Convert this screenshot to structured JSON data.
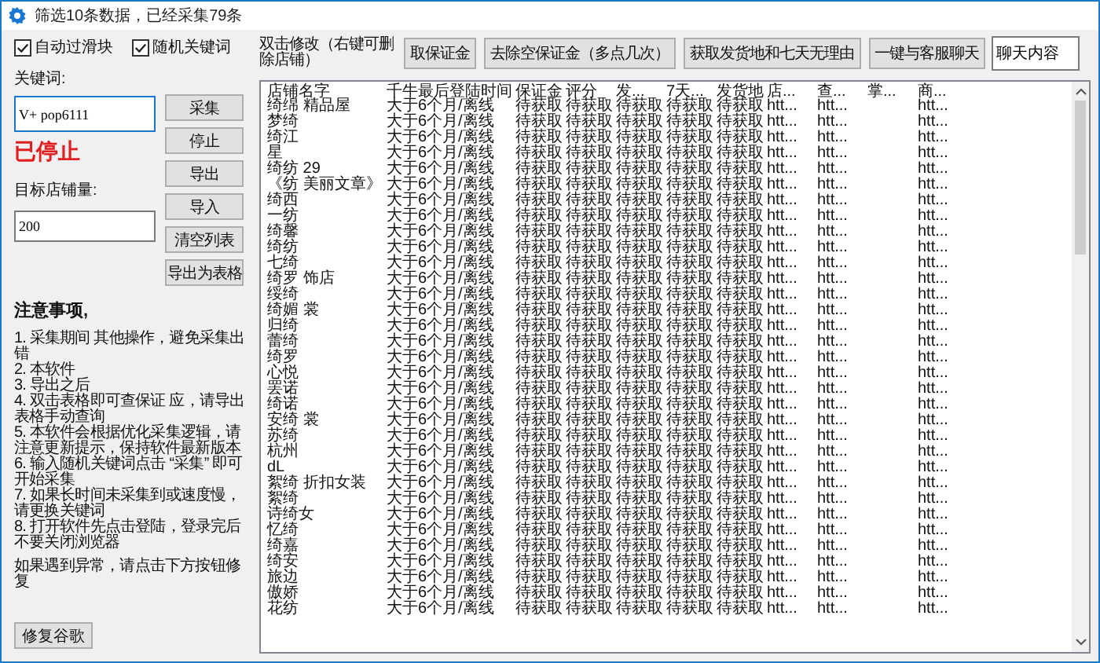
{
  "window": {
    "title": "筛选10条数据，已经采集79条"
  },
  "options": [
    {
      "label": "自动过滑块",
      "checked": true
    },
    {
      "label": "随机关键词",
      "checked": true
    }
  ],
  "keyword": {
    "label": "关键词:",
    "value": "V+ pop6111"
  },
  "status": {
    "text": "已停止",
    "kind": "stopped"
  },
  "target": {
    "label": "目标店铺量:",
    "value": "200"
  },
  "side_buttons": [
    "采集",
    "停止",
    "导出",
    "导入",
    "清空列表",
    "导出为表格"
  ],
  "notes": {
    "title": "注意事项,",
    "items": [
      "1. 采集期间 其他操作，避免采集出错",
      "2. 本软件",
      "3. 导出之后",
      "4. 双击表格即可查保证 应，请导出表格手动查询",
      "5. 本软件会根据优化采集逻辑，请注意更新提示，保持软件最新版本",
      "6. 输入随机关键词点击 “采集” 即可开始采集",
      "7. 如果长时间未采集到或速度慢，请更换关键词",
      "8. 打开软件先点击登陆，登录完后不要关闭浏览器"
    ],
    "footer": "如果遇到异常，请点击下方按钮修复"
  },
  "repair_button": "修复谷歌",
  "table_hint": "双击修改（右键可删除店铺）",
  "top_buttons": [
    "取保证金",
    "去除空保证金（多点几次）",
    "获取发货地和七天无理由",
    "一键与客服聊天"
  ],
  "chat": {
    "value": "聊天内容"
  },
  "table": {
    "columns": [
      "店铺名字",
      "千牛最后登陆时间",
      "保证金",
      "评分",
      "发...",
      "7天...",
      "发货地",
      "店...",
      "查...",
      "掌...",
      "商..."
    ],
    "rows": [
      [
        "绮绵 精品屋",
        "大于6个月/离线",
        "待获取",
        "待获取",
        "待获取",
        "待获取",
        "待获取",
        "htt...",
        "htt...",
        "",
        "htt..."
      ],
      [
        "梦绮",
        "大于6个月/离线",
        "待获取",
        "待获取",
        "待获取",
        "待获取",
        "待获取",
        "htt...",
        "htt...",
        "",
        "htt..."
      ],
      [
        "绮江",
        "大于6个月/离线",
        "待获取",
        "待获取",
        "待获取",
        "待获取",
        "待获取",
        "htt...",
        "htt...",
        "",
        "htt..."
      ],
      [
        "星",
        "大于6个月/离线",
        "待获取",
        "待获取",
        "待获取",
        "待获取",
        "待获取",
        "htt...",
        "htt...",
        "",
        "htt..."
      ],
      [
        "绮纺 29",
        "大于6个月/离线",
        "待获取",
        "待获取",
        "待获取",
        "待获取",
        "待获取",
        "htt...",
        "htt...",
        "",
        "htt..."
      ],
      [
        "《纺 美丽文章》",
        "大于6个月/离线",
        "待获取",
        "待获取",
        "待获取",
        "待获取",
        "待获取",
        "htt...",
        "htt...",
        "",
        "htt..."
      ],
      [
        "绮西",
        "大于6个月/离线",
        "待获取",
        "待获取",
        "待获取",
        "待获取",
        "待获取",
        "htt...",
        "htt...",
        "",
        "htt..."
      ],
      [
        "一纺",
        "大于6个月/离线",
        "待获取",
        "待获取",
        "待获取",
        "待获取",
        "待获取",
        "htt...",
        "htt...",
        "",
        "htt..."
      ],
      [
        "绮馨",
        "大于6个月/离线",
        "待获取",
        "待获取",
        "待获取",
        "待获取",
        "待获取",
        "htt...",
        "htt...",
        "",
        "htt..."
      ],
      [
        "绮纺",
        "大于6个月/离线",
        "待获取",
        "待获取",
        "待获取",
        "待获取",
        "待获取",
        "htt...",
        "htt...",
        "",
        "htt..."
      ],
      [
        "七绮",
        "大于6个月/离线",
        "待获取",
        "待获取",
        "待获取",
        "待获取",
        "待获取",
        "htt...",
        "htt...",
        "",
        "htt..."
      ],
      [
        "绮罗 饰店",
        "大于6个月/离线",
        "待获取",
        "待获取",
        "待获取",
        "待获取",
        "待获取",
        "htt...",
        "htt...",
        "",
        "htt..."
      ],
      [
        "绥绮",
        "大于6个月/离线",
        "待获取",
        "待获取",
        "待获取",
        "待获取",
        "待获取",
        "htt...",
        "htt...",
        "",
        "htt..."
      ],
      [
        "绮媚 裳",
        "大于6个月/离线",
        "待获取",
        "待获取",
        "待获取",
        "待获取",
        "待获取",
        "htt...",
        "htt...",
        "",
        "htt..."
      ],
      [
        "归绮",
        "大于6个月/离线",
        "待获取",
        "待获取",
        "待获取",
        "待获取",
        "待获取",
        "htt...",
        "htt...",
        "",
        "htt..."
      ],
      [
        "蕾绮",
        "大于6个月/离线",
        "待获取",
        "待获取",
        "待获取",
        "待获取",
        "待获取",
        "htt...",
        "htt...",
        "",
        "htt..."
      ],
      [
        "绮罗",
        "大于6个月/离线",
        "待获取",
        "待获取",
        "待获取",
        "待获取",
        "待获取",
        "htt...",
        "htt...",
        "",
        "htt..."
      ],
      [
        "心悦",
        "大于6个月/离线",
        "待获取",
        "待获取",
        "待获取",
        "待获取",
        "待获取",
        "htt...",
        "htt...",
        "",
        "htt..."
      ],
      [
        "罢诺",
        "大于6个月/离线",
        "待获取",
        "待获取",
        "待获取",
        "待获取",
        "待获取",
        "htt...",
        "htt...",
        "",
        "htt..."
      ],
      [
        "绮诺",
        "大于6个月/离线",
        "待获取",
        "待获取",
        "待获取",
        "待获取",
        "待获取",
        "htt...",
        "htt...",
        "",
        "htt..."
      ],
      [
        "安绮 裳",
        "大于6个月/离线",
        "待获取",
        "待获取",
        "待获取",
        "待获取",
        "待获取",
        "htt...",
        "htt...",
        "",
        "htt..."
      ],
      [
        "苏绮",
        "大于6个月/离线",
        "待获取",
        "待获取",
        "待获取",
        "待获取",
        "待获取",
        "htt...",
        "htt...",
        "",
        "htt..."
      ],
      [
        "杭州",
        "大于6个月/离线",
        "待获取",
        "待获取",
        "待获取",
        "待获取",
        "待获取",
        "htt...",
        "htt...",
        "",
        "htt..."
      ],
      [
        "dL",
        "大于6个月/离线",
        "待获取",
        "待获取",
        "待获取",
        "待获取",
        "待获取",
        "htt...",
        "htt...",
        "",
        "htt..."
      ],
      [
        "絮绮 折扣女装",
        "大于6个月/离线",
        "待获取",
        "待获取",
        "待获取",
        "待获取",
        "待获取",
        "htt...",
        "htt...",
        "",
        "htt..."
      ],
      [
        "絮绮",
        "大于6个月/离线",
        "待获取",
        "待获取",
        "待获取",
        "待获取",
        "待获取",
        "htt...",
        "htt...",
        "",
        "htt..."
      ],
      [
        "诗绮女",
        "大于6个月/离线",
        "待获取",
        "待获取",
        "待获取",
        "待获取",
        "待获取",
        "htt...",
        "htt...",
        "",
        "htt..."
      ],
      [
        "忆绮",
        "大于6个月/离线",
        "待获取",
        "待获取",
        "待获取",
        "待获取",
        "待获取",
        "htt...",
        "htt...",
        "",
        "htt..."
      ],
      [
        "绮嘉",
        "大于6个月/离线",
        "待获取",
        "待获取",
        "待获取",
        "待获取",
        "待获取",
        "htt...",
        "htt...",
        "",
        "htt..."
      ],
      [
        "绮安",
        "大于6个月/离线",
        "待获取",
        "待获取",
        "待获取",
        "待获取",
        "待获取",
        "htt...",
        "htt...",
        "",
        "htt..."
      ],
      [
        "旅边",
        "大于6个月/离线",
        "待获取",
        "待获取",
        "待获取",
        "待获取",
        "待获取",
        "htt...",
        "htt...",
        "",
        "htt..."
      ],
      [
        "傲娇",
        "大于6个月/离线",
        "待获取",
        "待获取",
        "待获取",
        "待获取",
        "待获取",
        "htt...",
        "htt...",
        "",
        "htt..."
      ],
      [
        "花纺",
        "大于6个月/离线",
        "待获取",
        "待获取",
        "待获取",
        "待获取",
        "待获取",
        "htt...",
        "htt...",
        "",
        "htt..."
      ]
    ]
  }
}
